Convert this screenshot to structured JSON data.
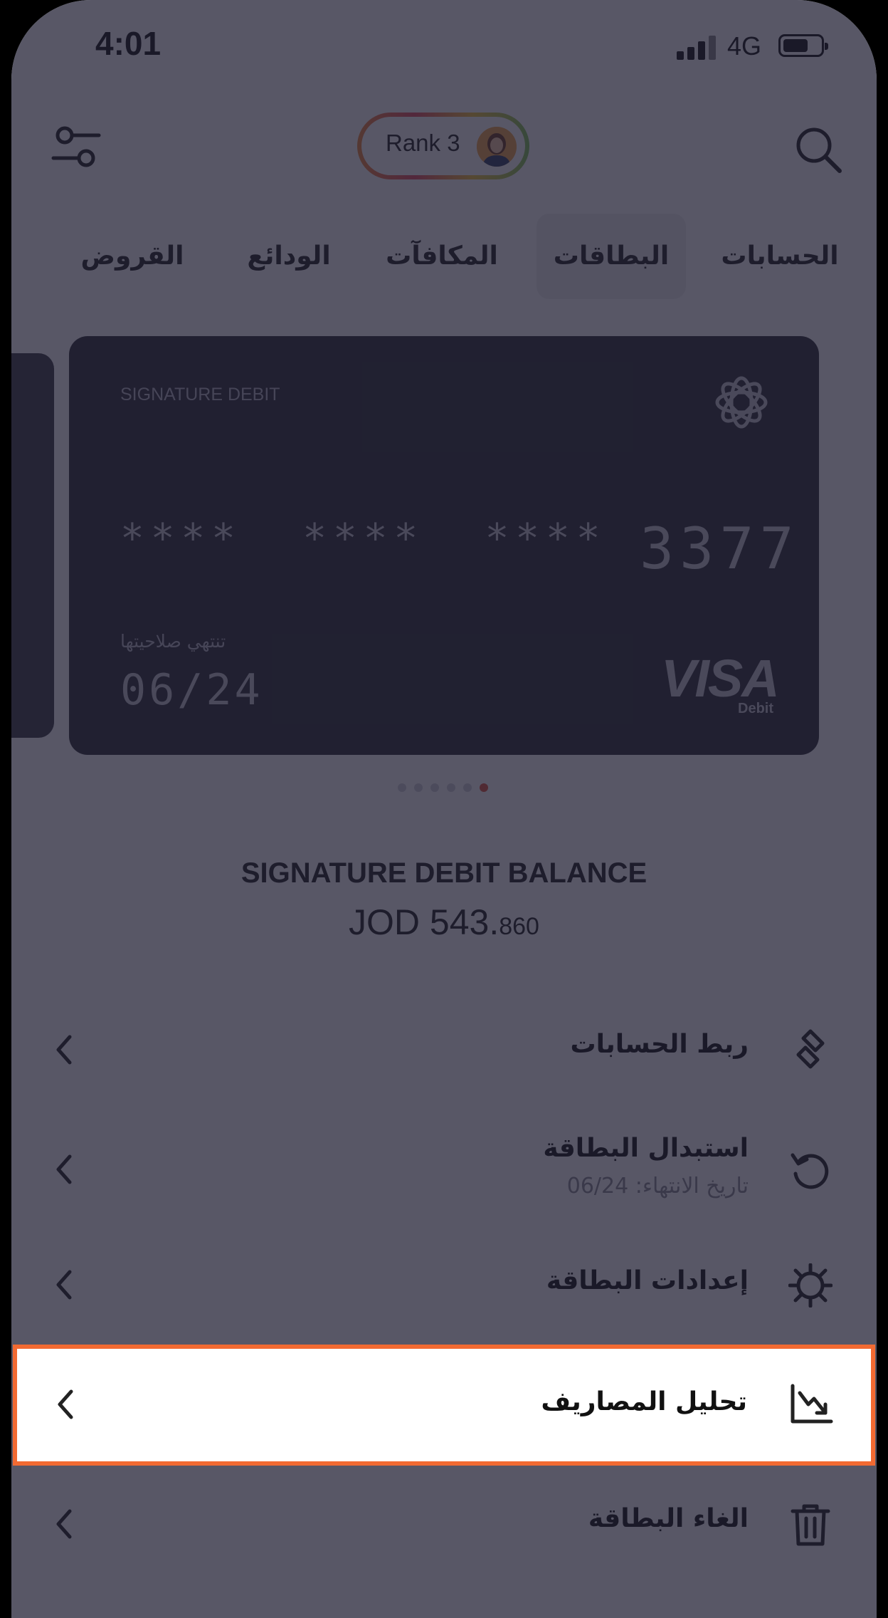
{
  "status_bar": {
    "time": "4:01",
    "network": "4G"
  },
  "header": {
    "rank_label": "Rank 3"
  },
  "tabs": [
    {
      "label": "الحسابات"
    },
    {
      "label": "البطاقات",
      "active": true
    },
    {
      "label": "المكافآت"
    },
    {
      "label": "الودائع"
    },
    {
      "label": "القروض"
    }
  ],
  "card": {
    "type_label": "SIGNATURE DEBIT",
    "masked_number": "****  ****  ****",
    "last4": "3377",
    "expiry_label": "تنتهي صلاحيتها",
    "expiry": "06/24",
    "brand": "VISA",
    "brand_sub": "Debit"
  },
  "carousel": {
    "total": 6,
    "active_index": 5,
    "active_color": "#e0523a"
  },
  "balance": {
    "title": "SIGNATURE DEBIT BALANCE",
    "amount_main": "JOD 543.",
    "amount_decimal": "860"
  },
  "actions": [
    {
      "title": "ربط الحسابات",
      "icon": "link-icon"
    },
    {
      "title": "استبدال البطاقة",
      "subtitle": "تاريخ الانتهاء: 06/24",
      "icon": "refresh-icon"
    },
    {
      "title": "إعدادات البطاقة",
      "icon": "gear-icon"
    },
    {
      "title": "تحليل المصاريف",
      "icon": "chart-down-icon",
      "highlighted": true
    },
    {
      "title": "الغاء البطاقة",
      "icon": "trash-icon"
    }
  ],
  "colors": {
    "highlight_border": "#f26a32",
    "overlay": "#1e1d30",
    "card_background": "#2b2b35"
  }
}
